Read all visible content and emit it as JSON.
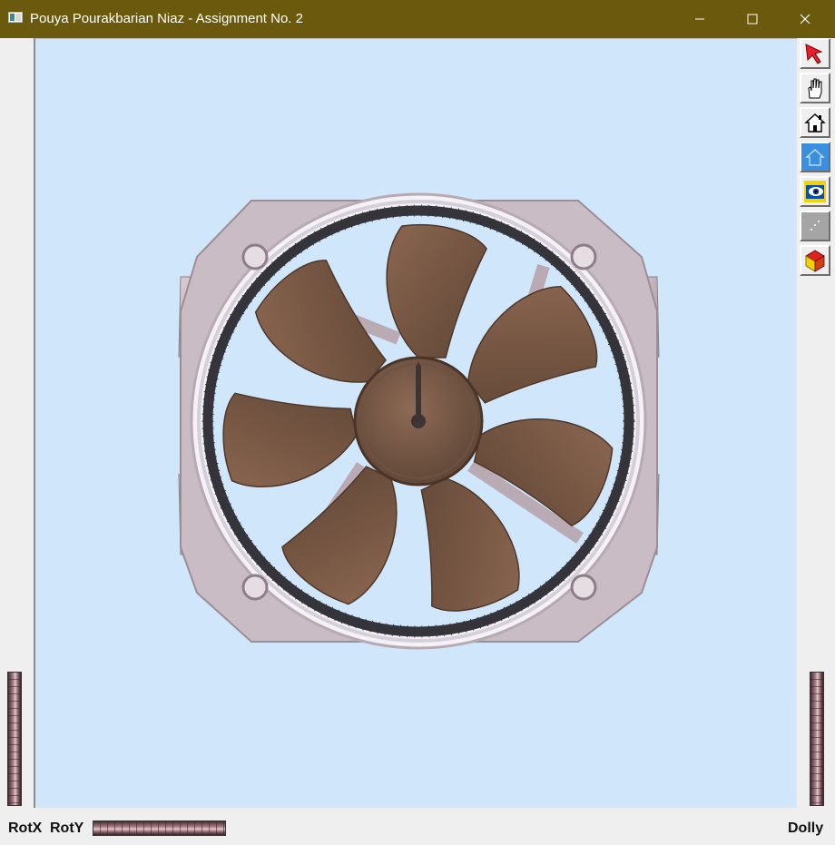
{
  "window": {
    "title": "Pouya Pourakbarian Niaz - Assignment No. 2",
    "titlebar_color": "#6b5a0e",
    "controls": [
      "minimize-icon",
      "maximize-icon",
      "close-icon"
    ]
  },
  "viewer": {
    "background_color": "#d0e6fb",
    "scene_description_icon": "fan-model",
    "fan_blade_color": "#7b5a46",
    "fan_frame_color": "#c4b4bd",
    "fan_ring_color": "#34343a",
    "blade_count": 7
  },
  "toolbar": {
    "buttons": [
      {
        "name": "select-pick",
        "icon": "arrow-pointer-icon"
      },
      {
        "name": "view-interact",
        "icon": "hand-icon"
      },
      {
        "name": "home",
        "icon": "home-icon"
      },
      {
        "name": "set-home",
        "icon": "set-home-icon"
      },
      {
        "name": "view-all",
        "icon": "eye-icon"
      },
      {
        "name": "seek",
        "icon": "seek-icon"
      },
      {
        "name": "perspective",
        "icon": "cube-icon"
      }
    ]
  },
  "bottom_bar": {
    "rotx_label": "RotX",
    "roty_label": "RotY",
    "dolly_label": "Dolly"
  }
}
